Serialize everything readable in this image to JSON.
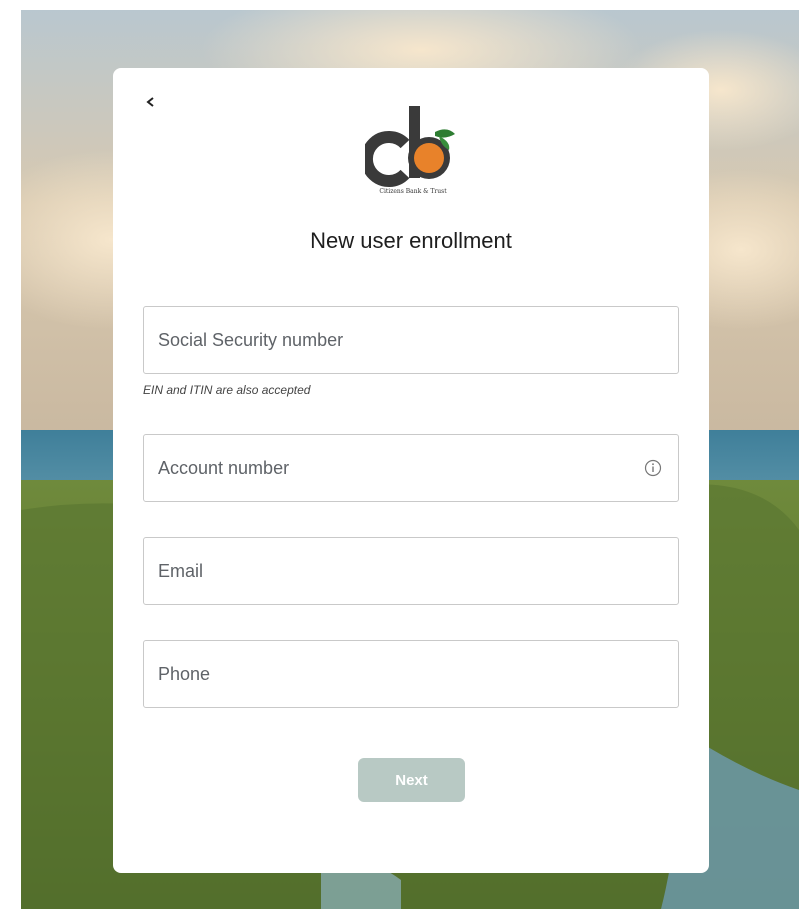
{
  "brand": {
    "logo_caption": "Citizens Bank & Trust"
  },
  "header": {
    "back_icon": "chevron-left-icon",
    "title": "New user enrollment"
  },
  "form": {
    "ssn": {
      "placeholder": "Social Security number",
      "value": ""
    },
    "ssn_hint": "EIN and ITIN are also accepted",
    "account": {
      "placeholder": "Account number",
      "value": "",
      "icon": "info-icon"
    },
    "email": {
      "placeholder": "Email",
      "value": ""
    },
    "phone": {
      "placeholder": "Phone",
      "value": ""
    },
    "next_label": "Next"
  },
  "colors": {
    "logo_dark": "#3a3a3a",
    "logo_orange": "#e8822a",
    "logo_leaf": "#2e7d32",
    "button_disabled": "#b8c9c4"
  }
}
